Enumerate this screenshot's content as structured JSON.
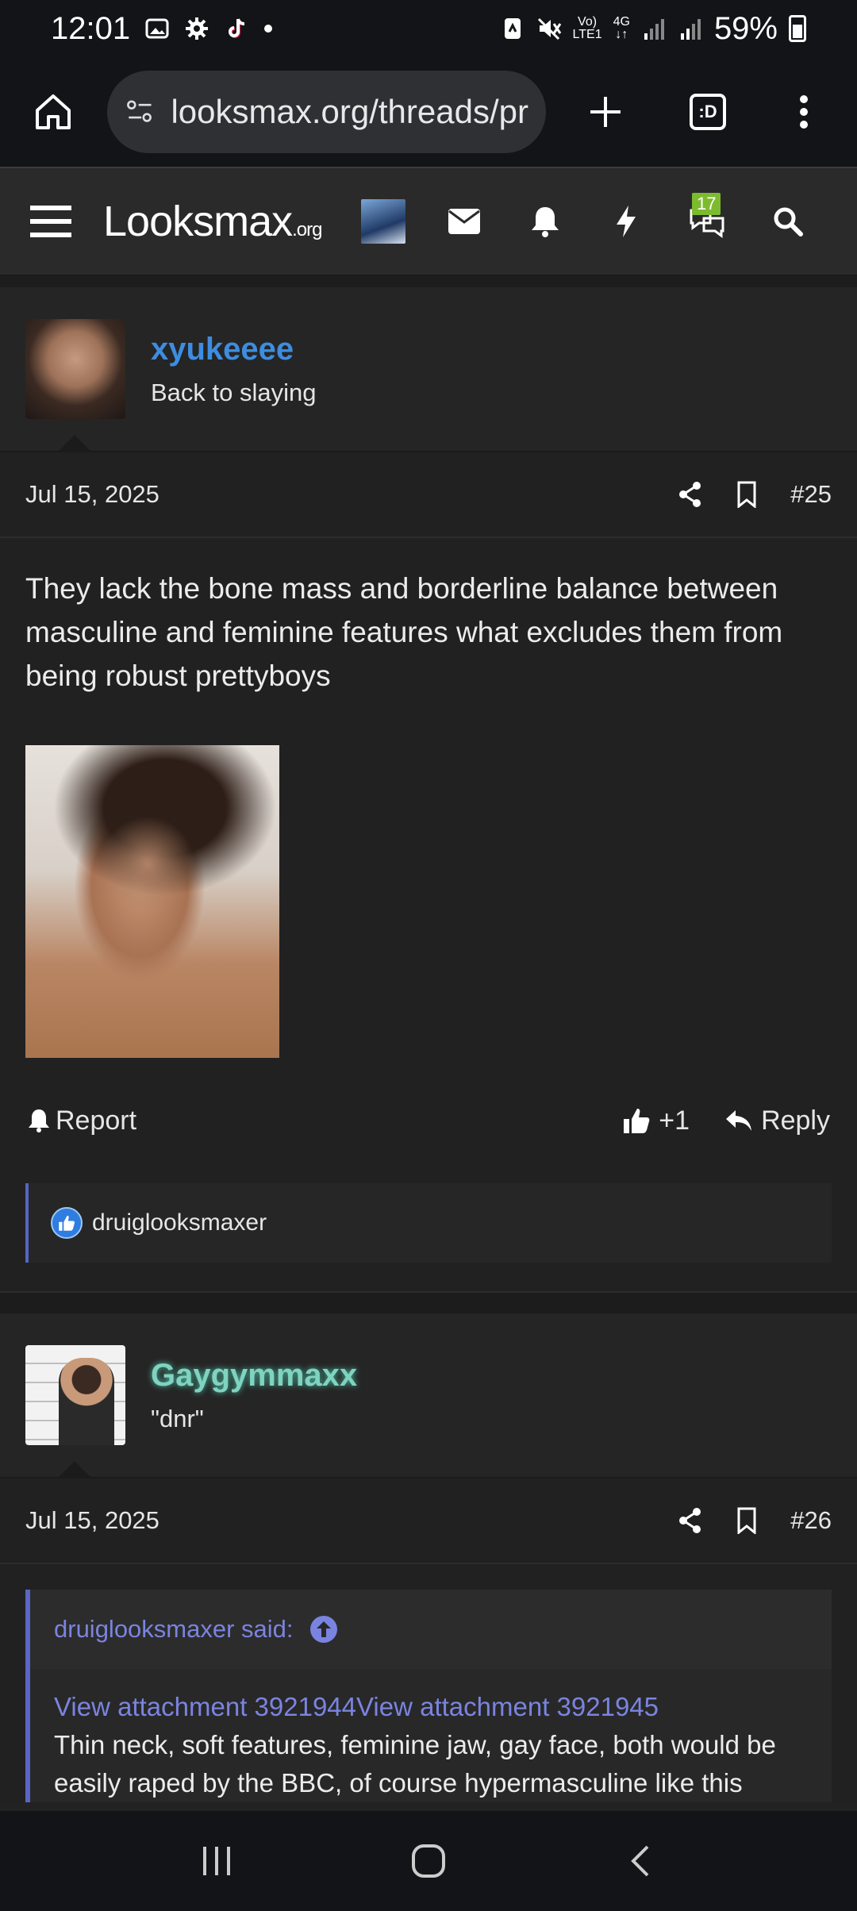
{
  "status_bar": {
    "time": "12:01",
    "network_top": "Vo)",
    "network_bottom": "LTE1",
    "net_type": "4G",
    "battery": "59%"
  },
  "browser": {
    "url": "looksmax.org/threads/pr",
    "tab_count_label": ":D"
  },
  "site_nav": {
    "logo_main": "Looksmax",
    "logo_suffix": ".org",
    "messages_badge": "17"
  },
  "posts": [
    {
      "username": "xyukeeee",
      "user_title": "Back to slaying",
      "date": "Jul 15, 2025",
      "post_number": "#25",
      "body": "They lack the bone mass and borderline balance between masculine and feminine features what excludes them from being robust prettyboys",
      "report_label": "Report",
      "like_count": "+1",
      "reply_label": "Reply",
      "reaction_user": "druiglooksmaxer"
    },
    {
      "username": "Gaygymmaxx",
      "user_title": "\"dnr\"",
      "date": "Jul 15, 2025",
      "post_number": "#26",
      "quote_author": "druiglooksmaxer said:",
      "quote_links": "View attachment 3921944View attachment 3921945",
      "quote_text": "Thin neck, soft features, feminine jaw, gay face, both would be easily raped by the BBC, of course hypermasculine like this"
    }
  ],
  "colors": {
    "accent": "#3d8de0",
    "quote": "#5a66c4",
    "badge": "#7dbb2e"
  }
}
